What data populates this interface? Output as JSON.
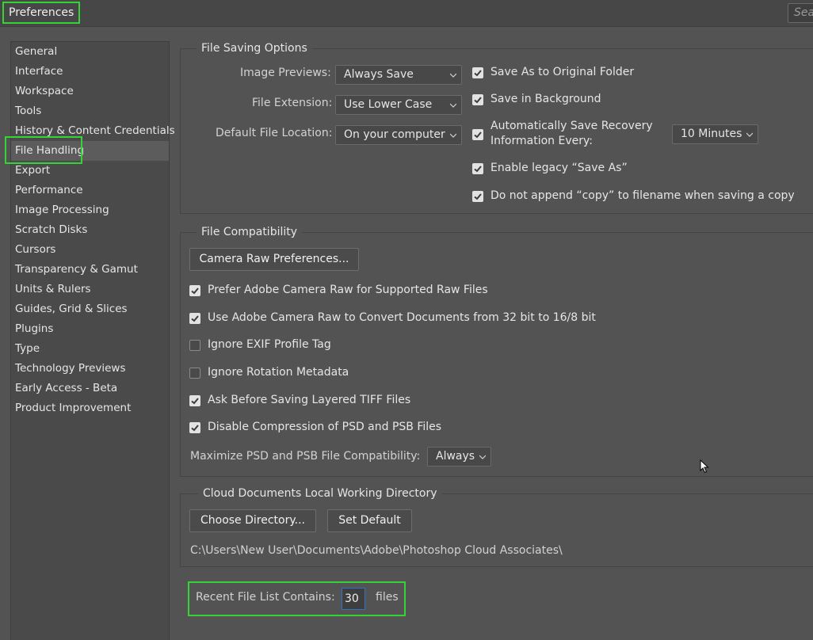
{
  "window": {
    "title": "Preferences",
    "search_placeholder": "Sea"
  },
  "sidebar": {
    "items": [
      {
        "label": "General"
      },
      {
        "label": "Interface"
      },
      {
        "label": "Workspace"
      },
      {
        "label": "Tools"
      },
      {
        "label": "History & Content Credentials"
      },
      {
        "label": "File Handling"
      },
      {
        "label": "Export"
      },
      {
        "label": "Performance"
      },
      {
        "label": "Image Processing"
      },
      {
        "label": "Scratch Disks"
      },
      {
        "label": "Cursors"
      },
      {
        "label": "Transparency & Gamut"
      },
      {
        "label": "Units & Rulers"
      },
      {
        "label": "Guides, Grid & Slices"
      },
      {
        "label": "Plugins"
      },
      {
        "label": "Type"
      },
      {
        "label": "Technology Previews"
      },
      {
        "label": "Early Access - Beta"
      },
      {
        "label": "Product Improvement"
      }
    ],
    "selected": "File Handling"
  },
  "file_saving": {
    "title": "File Saving Options",
    "image_previews_label": "Image Previews:",
    "image_previews_value": "Always Save",
    "file_extension_label": "File Extension:",
    "file_extension_value": "Use Lower Case",
    "default_location_label": "Default File Location:",
    "default_location_value": "On your computer",
    "save_original_folder": {
      "label": "Save As to Original Folder",
      "checked": true
    },
    "save_background": {
      "label": "Save in Background",
      "checked": true
    },
    "auto_save_recovery": {
      "label_line1": "Automatically Save Recovery",
      "label_line2": "Information Every:",
      "checked": true
    },
    "auto_save_interval": "10 Minutes",
    "legacy_save_as": {
      "label": "Enable legacy “Save As”",
      "checked": true
    },
    "no_copy_suffix": {
      "label": "Do not append “copy” to filename when saving a copy",
      "checked": true
    }
  },
  "file_compat": {
    "title": "File Compatibility",
    "camera_raw_button": "Camera Raw Preferences...",
    "options": [
      {
        "label": "Prefer Adobe Camera Raw for Supported Raw Files",
        "checked": true
      },
      {
        "label": "Use Adobe Camera Raw to Convert Documents from 32 bit to 16/8 bit",
        "checked": true
      },
      {
        "label": "Ignore EXIF Profile Tag",
        "checked": false
      },
      {
        "label": "Ignore Rotation Metadata",
        "checked": false
      },
      {
        "label": "Ask Before Saving Layered TIFF Files",
        "checked": true
      },
      {
        "label": "Disable Compression of PSD and PSB Files",
        "checked": true
      }
    ],
    "maximize_label": "Maximize PSD and PSB File Compatibility:",
    "maximize_value": "Always"
  },
  "cloud_docs": {
    "title": "Cloud Documents Local Working Directory",
    "choose_button": "Choose Directory...",
    "default_button": "Set Default",
    "path": "C:\\Users\\New User\\Documents\\Adobe\\Photoshop Cloud Associates\\"
  },
  "recent": {
    "label": "Recent File List Contains:",
    "value": "30",
    "suffix": "files"
  },
  "colors": {
    "background": "#535353",
    "highlight": "#35d335",
    "focus": "#2f74c0"
  },
  "icons": {
    "checkmark": "check-icon",
    "dropdown": "chevron-down-icon",
    "cursor": "mouse-pointer-icon"
  }
}
